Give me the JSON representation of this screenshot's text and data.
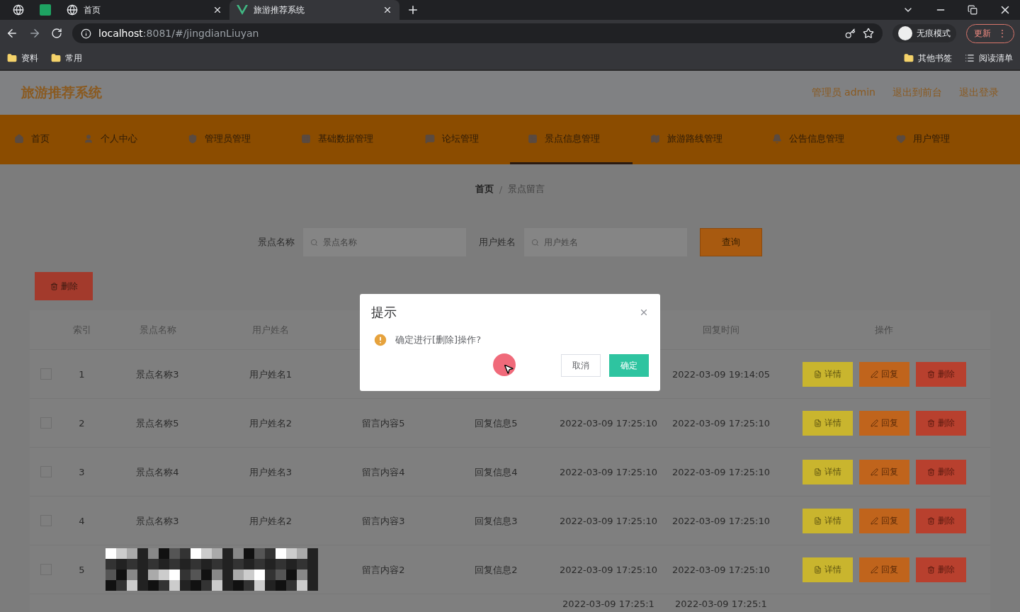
{
  "browser": {
    "tabs": [
      {
        "kind": "globe",
        "selected": false
      },
      {
        "kind": "sheet",
        "selected": false
      },
      {
        "kind": "globe",
        "title": "首页",
        "selected": false
      },
      {
        "kind": "vue",
        "title": "旅游推荐系统",
        "selected": true
      }
    ],
    "url": {
      "host": "localhost",
      "path": ":8081/#/jingdianLiuyan"
    },
    "profile": "无痕模式",
    "update": "更新",
    "menu": "⋮",
    "bookmarks": [
      "资料",
      "常用"
    ],
    "bookmarks_right": [
      {
        "kind": "folder",
        "label": "其他书签"
      },
      {
        "kind": "list",
        "label": "阅读清单"
      }
    ]
  },
  "header": {
    "title": "旅游推荐系统",
    "links": [
      "管理员 admin",
      "退出到前台",
      "退出登录"
    ]
  },
  "nav": [
    {
      "label": "首页",
      "selected": false
    },
    {
      "label": "个人中心",
      "selected": false
    },
    {
      "label": "管理员管理",
      "selected": false
    },
    {
      "label": "基础数据管理",
      "selected": false
    },
    {
      "label": "论坛管理",
      "selected": false
    },
    {
      "label": "景点信息管理",
      "selected": true
    },
    {
      "label": "旅游路线管理",
      "selected": false
    },
    {
      "label": "公告信息管理",
      "selected": false
    },
    {
      "label": "用户管理",
      "selected": false
    }
  ],
  "breadcrumb": [
    "首页",
    "景点留言"
  ],
  "breadcrumb_separator": "/",
  "search": {
    "fields": [
      {
        "label": "景点名称",
        "placeholder": "景点名称"
      },
      {
        "label": "用户姓名",
        "placeholder": "用户姓名"
      }
    ],
    "button": "查询"
  },
  "batch_delete": "删除",
  "table": {
    "columns": [
      {
        "label": "索引"
      },
      {
        "label": "景点名称"
      },
      {
        "label": "用户姓名"
      },
      {},
      {},
      {},
      {
        "label": "回复时间"
      },
      {
        "label": "操作"
      }
    ],
    "rows": [
      {
        "kind": "plain",
        "checked": false,
        "index": "1",
        "spot": "景点名称3",
        "user": "用户姓名1",
        "reply_time": "2022-03-09 19:14:05",
        "actions": [
          "详情",
          "回复",
          "删除"
        ]
      },
      {
        "kind": "plain",
        "checked": false,
        "index": "2",
        "spot": "景点名称5",
        "user": "用户姓名2",
        "message": "留言内容5",
        "reply": "回复信息5",
        "message_time": "2022-03-09 17:25:10",
        "reply_time": "2022-03-09 17:25:10",
        "actions": [
          "详情",
          "回复",
          "删除"
        ]
      },
      {
        "kind": "plain",
        "checked": false,
        "index": "3",
        "spot": "景点名称4",
        "user": "用户姓名3",
        "message": "留言内容4",
        "reply": "回复信息4",
        "message_time": "2022-03-09 17:25:10",
        "reply_time": "2022-03-09 17:25:10",
        "actions": [
          "详情",
          "回复",
          "删除"
        ]
      },
      {
        "kind": "plain",
        "checked": false,
        "index": "4",
        "spot": "景点名称3",
        "user": "用户姓名2",
        "message": "留言内容3",
        "reply": "回复信息3",
        "message_time": "2022-03-09 17:25:10",
        "reply_time": "2022-03-09 17:25:10",
        "actions": [
          "详情",
          "回复",
          "删除"
        ]
      },
      {
        "kind": "redacted",
        "checked": false,
        "index": "5",
        "message": "留言内容2",
        "reply": "回复信息2",
        "message_time": "2022-03-09 17:25:10",
        "reply_time": "2022-03-09 17:25:10",
        "actions": [
          "详情",
          "回复",
          "删除"
        ]
      },
      {
        "kind": "cut",
        "message_time": "2022-03-09 17:25:1",
        "reply_time": "2022-03-09 17:25:1",
        "actions": []
      }
    ]
  },
  "dialog": {
    "title": "提示",
    "message": "确定进行[删除]操作?",
    "cancel": "取消",
    "confirm": "确定"
  }
}
